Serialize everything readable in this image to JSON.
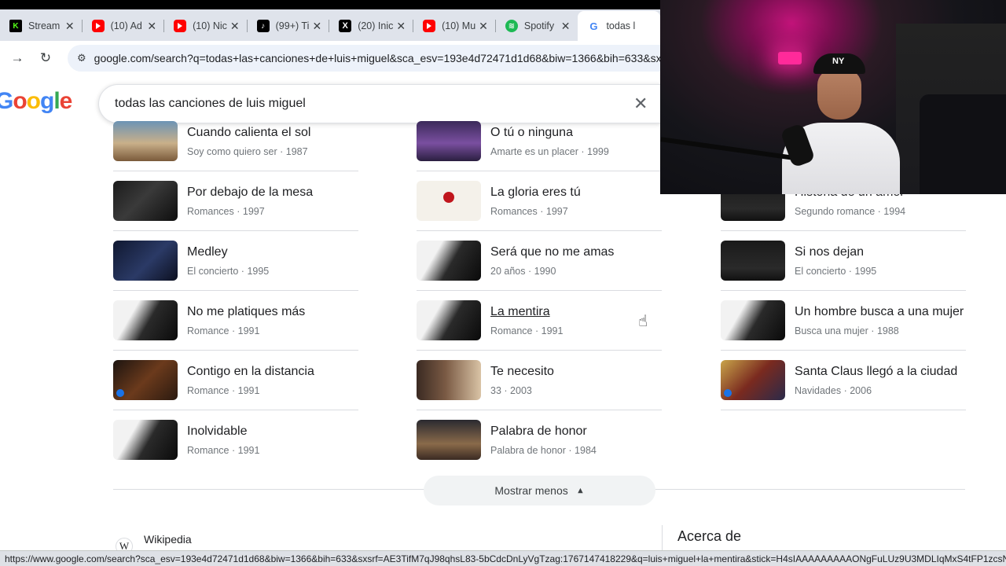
{
  "browser": {
    "tabs": [
      {
        "title": "Stream",
        "icon": "kick-icon"
      },
      {
        "title": "(10) Ad",
        "icon": "youtube-icon"
      },
      {
        "title": "(10) Nic",
        "icon": "youtube-icon"
      },
      {
        "title": "(99+) Ti",
        "icon": "tiktok-icon"
      },
      {
        "title": "(20) Inic",
        "icon": "x-icon"
      },
      {
        "title": "(10) Mu",
        "icon": "youtube-icon"
      },
      {
        "title": "Spotify",
        "icon": "spotify-icon"
      },
      {
        "title": "todas l",
        "icon": "google-icon"
      }
    ],
    "url": "google.com/search?q=todas+las+canciones+de+luis+miguel&sca_esv=193e4d72471d1d68&biw=1366&bih=633&sxsrf",
    "status_url": "https://www.google.com/search?sca_esv=193e4d72471d1d68&biw=1366&bih=633&sxsrf=AE3TifM7qJ98qhsL83-5bCdcDnLyVgTzag:1767147418229&q=luis+miguel+la+mentira&stick=H4sIAAAAAAAAAONgFuLUz9U3MDLIqMxS4tFP1zcsNM1KNjLO..."
  },
  "search": {
    "logo": "Google",
    "query": "todas las canciones de luis miguel"
  },
  "songs": {
    "col1": [
      {
        "title": "Cuando calienta el sol",
        "album": "Soy como quiero ser",
        "year": "1987"
      },
      {
        "title": "Por debajo de la mesa",
        "album": "Romances",
        "year": "1997"
      },
      {
        "title": "Medley",
        "album": "El concierto",
        "year": "1995"
      },
      {
        "title": "No me platiques más",
        "album": "Romance",
        "year": "1991"
      },
      {
        "title": "Contigo en la distancia",
        "album": "Romance",
        "year": "1991"
      },
      {
        "title": "Inolvidable",
        "album": "Romance",
        "year": "1991"
      }
    ],
    "col2": [
      {
        "title": "O tú o ninguna",
        "album": "Amarte es un placer",
        "year": "1999"
      },
      {
        "title": "La gloria eres tú",
        "album": "Romances",
        "year": "1997"
      },
      {
        "title": "Será que no me amas",
        "album": "20 años",
        "year": "1990"
      },
      {
        "title": "La mentira",
        "album": "Romance",
        "year": "1991"
      },
      {
        "title": "Te necesito",
        "album": "33",
        "year": "2003"
      },
      {
        "title": "Palabra de honor",
        "album": "Palabra de honor",
        "year": "1984"
      }
    ],
    "col3": [
      {
        "title": "Historia de un amor",
        "album": "Segundo romance",
        "year": "1994"
      },
      {
        "title": "Si nos dejan",
        "album": "El concierto",
        "year": "1995"
      },
      {
        "title": "Un hombre busca a una mujer",
        "album": "Busca una mujer",
        "year": "1988"
      },
      {
        "title": "Santa Claus llegó a la ciudad",
        "album": "Navidades",
        "year": "2006"
      }
    ],
    "meta_separator": "·"
  },
  "show_less_label": "Mostrar menos",
  "bottom": {
    "source": "Wikipedia",
    "about": "Acerca de"
  }
}
